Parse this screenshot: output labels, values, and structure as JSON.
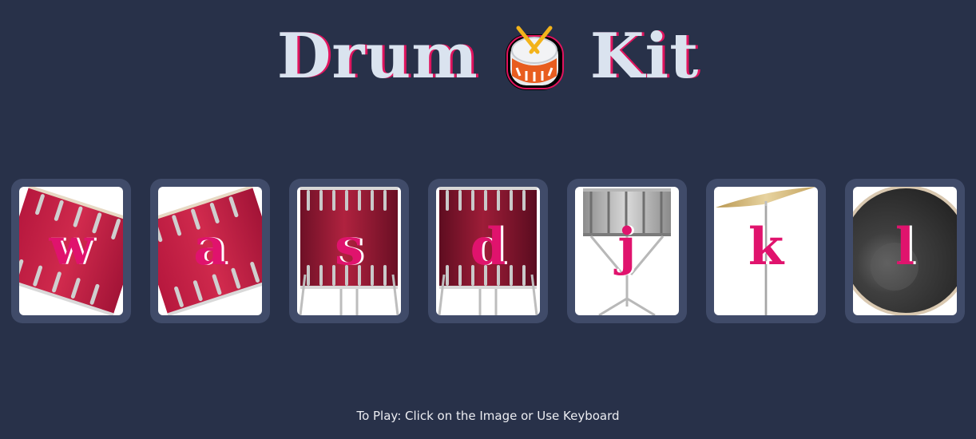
{
  "header": {
    "title_left": "Drum",
    "title_right": "Kit",
    "logo_icon": "drum-with-sticks-icon"
  },
  "drums": [
    {
      "key": "w",
      "image": "tom-drum-tilted-icon"
    },
    {
      "key": "a",
      "image": "tom-drum-tilted-icon"
    },
    {
      "key": "s",
      "image": "floor-tom-icon"
    },
    {
      "key": "d",
      "image": "floor-tom-icon"
    },
    {
      "key": "j",
      "image": "snare-drum-on-stand-icon"
    },
    {
      "key": "k",
      "image": "crash-cymbal-icon"
    },
    {
      "key": "l",
      "image": "bass-drum-icon"
    }
  ],
  "footer": {
    "instructions": "To Play: Click on the Image or Use Keyboard"
  },
  "colors": {
    "background": "#283149",
    "card_frame": "#404b69",
    "accent": "#e0136d",
    "title": "#dae3ef"
  }
}
